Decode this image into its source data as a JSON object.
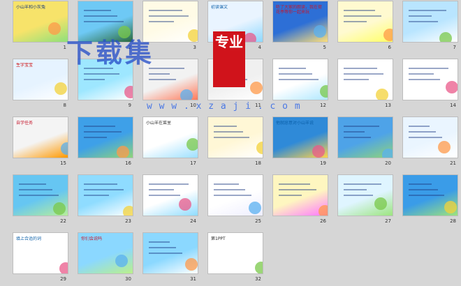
{
  "view": "slide-sorter",
  "slides": [
    {
      "n": "1",
      "text": "小山羊和小灰兔"
    },
    {
      "n": "2",
      "text": ""
    },
    {
      "n": "3",
      "text": ""
    },
    {
      "n": "4",
      "text": "初读课文"
    },
    {
      "n": "5",
      "text": "听了大家的朗读，我在荷花亭等你一起来玩"
    },
    {
      "n": "6",
      "text": ""
    },
    {
      "n": "7",
      "text": ""
    },
    {
      "n": "8",
      "text": "生字宝宝"
    },
    {
      "n": "9",
      "text": ""
    },
    {
      "n": "10",
      "text": ""
    },
    {
      "n": "11",
      "text": ""
    },
    {
      "n": "12",
      "text": ""
    },
    {
      "n": "13",
      "text": ""
    },
    {
      "n": "14",
      "text": ""
    },
    {
      "n": "15",
      "text": "自学任务"
    },
    {
      "n": "16",
      "text": ""
    },
    {
      "n": "17",
      "text": "小山羊在菜里"
    },
    {
      "n": "18",
      "text": ""
    },
    {
      "n": "19",
      "text": "他就愿意对小山羊说"
    },
    {
      "n": "20",
      "text": ""
    },
    {
      "n": "21",
      "text": ""
    },
    {
      "n": "22",
      "text": ""
    },
    {
      "n": "23",
      "text": ""
    },
    {
      "n": "24",
      "text": ""
    },
    {
      "n": "25",
      "text": ""
    },
    {
      "n": "26",
      "text": ""
    },
    {
      "n": "27",
      "text": ""
    },
    {
      "n": "28",
      "text": ""
    },
    {
      "n": "29",
      "text": "填上合适的词"
    },
    {
      "n": "30",
      "text": "你们会说吗"
    },
    {
      "n": "31",
      "text": ""
    },
    {
      "n": "32",
      "text": "第1PPT"
    }
  ],
  "watermark": {
    "big": "下载集",
    "seal": "专业",
    "url": "w w w . x z a j i . c o m"
  }
}
